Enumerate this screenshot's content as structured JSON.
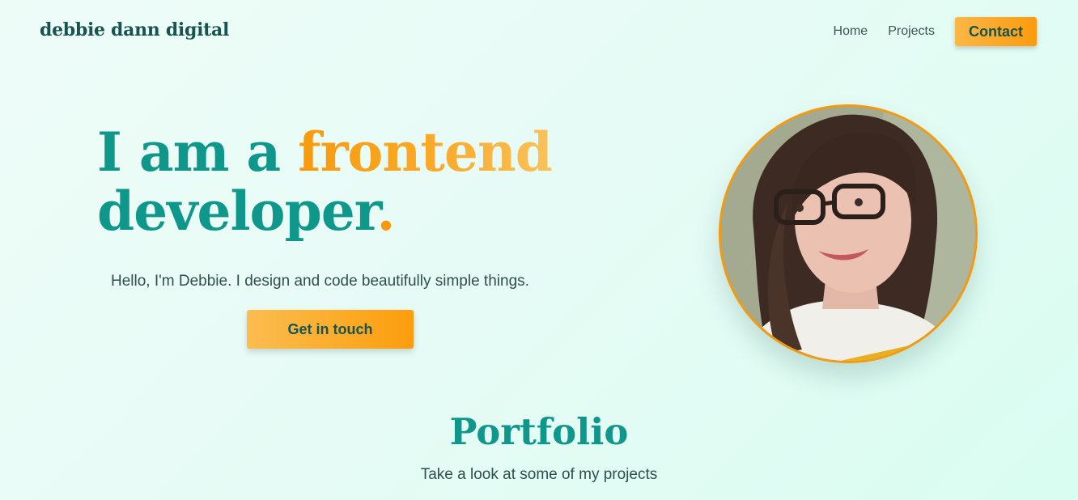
{
  "header": {
    "logo": "debbie dann digital",
    "nav": [
      {
        "label": "Home"
      },
      {
        "label": "Projects"
      }
    ],
    "contact_label": "Contact"
  },
  "hero": {
    "title_part1": "I am a ",
    "title_highlight": "frontend",
    "title_part2": "developer",
    "title_dot": ".",
    "intro": "Hello, I'm Debbie. I design and code beautifully simple things.",
    "cta_label": "Get in touch",
    "portrait_icon": "profile-photo"
  },
  "portfolio": {
    "title": "Portfolio",
    "subtitle": "Take a look at some of my projects"
  },
  "colors": {
    "primary_teal": "#0f978b",
    "accent_orange": "#fb9b0c",
    "dark_green": "#17544f",
    "background": "#e6fbf5"
  }
}
